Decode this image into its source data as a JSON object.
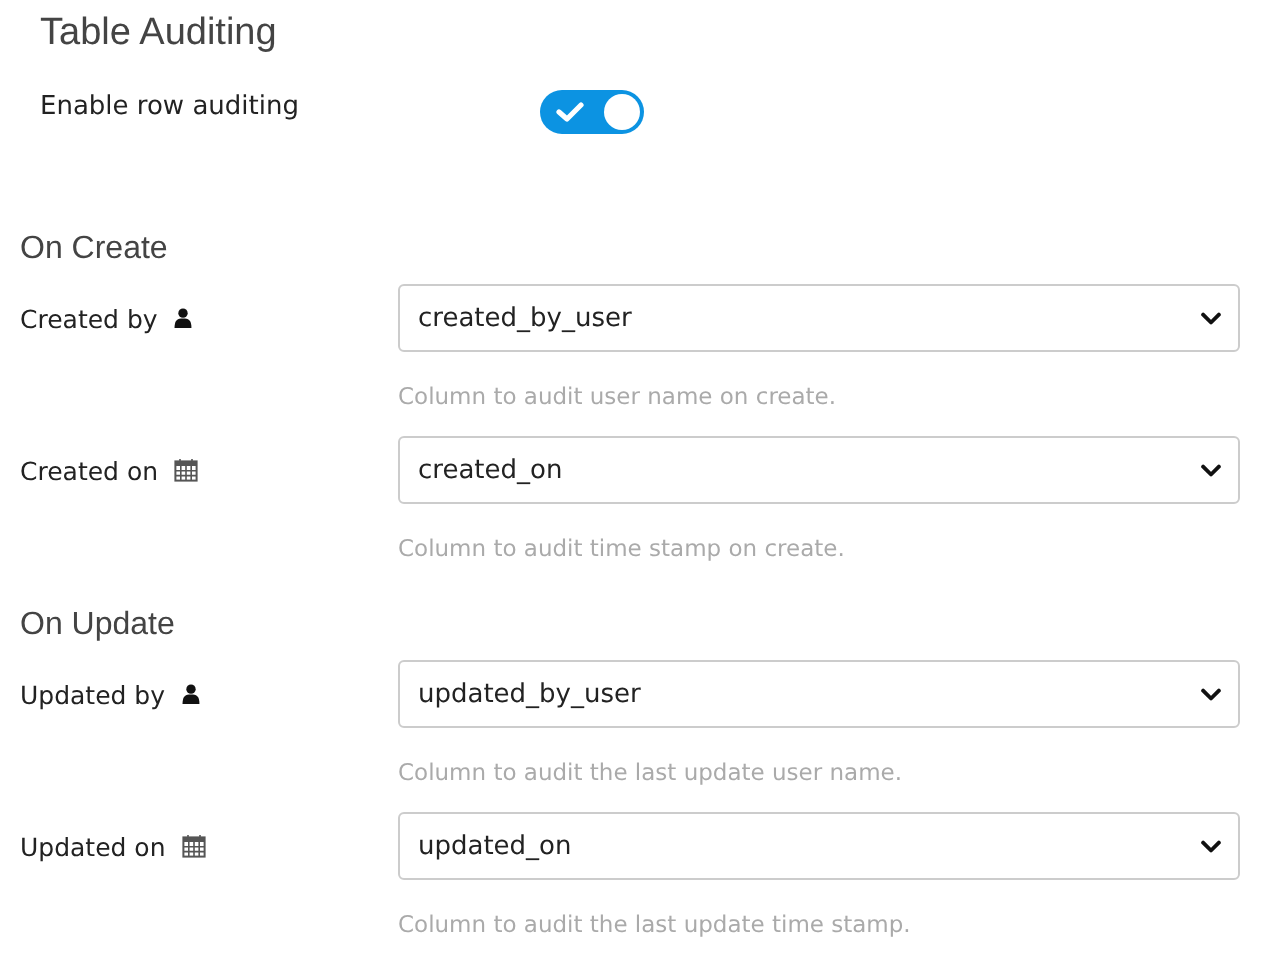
{
  "title": "Table Auditing",
  "toggle": {
    "label": "Enable row auditing",
    "on": true
  },
  "sections": [
    {
      "heading": "On Create",
      "fields": [
        {
          "label": "Created by",
          "kind": "user",
          "value": "created_by_user",
          "help": "Column to audit user name on create."
        },
        {
          "label": "Created on",
          "kind": "calendar",
          "value": "created_on",
          "help": "Column to audit time stamp on create."
        }
      ]
    },
    {
      "heading": "On Update",
      "fields": [
        {
          "label": "Updated by",
          "kind": "user",
          "value": "updated_by_user",
          "help": "Column to audit the last update user name."
        },
        {
          "label": "Updated on",
          "kind": "calendar",
          "value": "updated_on",
          "help": "Column to audit the last update time stamp."
        }
      ]
    }
  ]
}
